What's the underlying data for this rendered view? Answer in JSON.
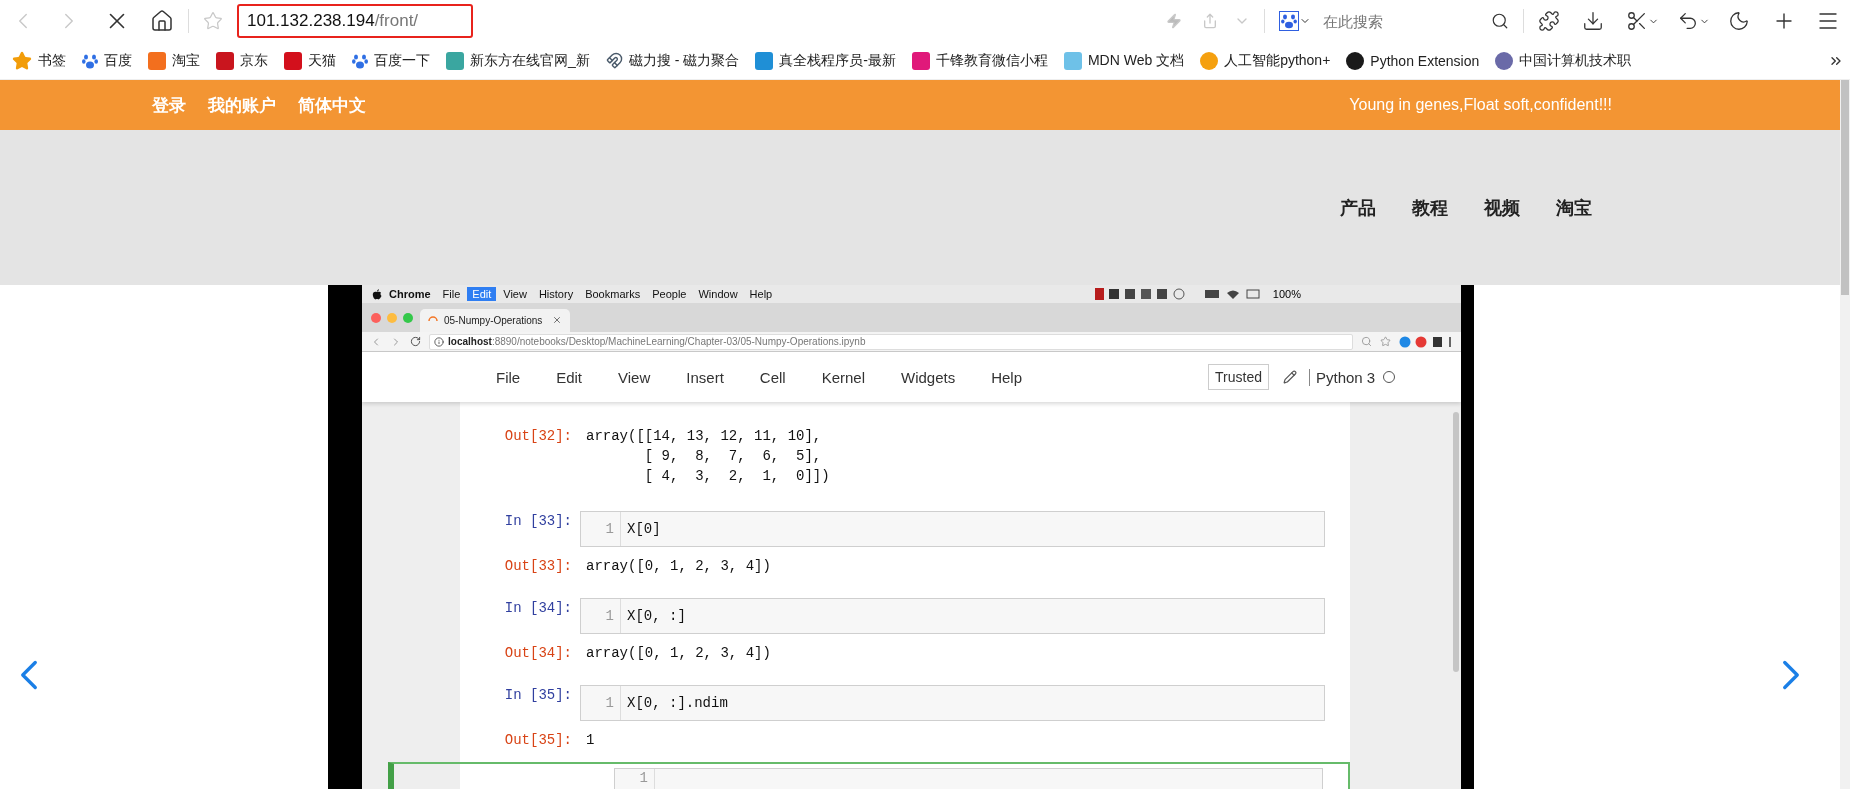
{
  "browser": {
    "address_host": "101.132.238.194",
    "address_path": "/front/",
    "search_placeholder": "在此搜索"
  },
  "bookmarks": [
    {
      "label": "书签",
      "kind": "star",
      "color": "#f29d0a"
    },
    {
      "label": "百度",
      "kind": "paw",
      "color": "#2f6fe4"
    },
    {
      "label": "淘宝",
      "kind": "tile",
      "color": "#f36f1e"
    },
    {
      "label": "京东",
      "kind": "tile",
      "color": "#c9151e"
    },
    {
      "label": "天猫",
      "kind": "tile",
      "color": "#d3101c"
    },
    {
      "label": "百度一下",
      "kind": "paw",
      "color": "#2f6fe4"
    },
    {
      "label": "新东方在线官网_新",
      "kind": "tile",
      "color": "#3aa6a0"
    },
    {
      "label": "磁力搜 - 磁力聚合",
      "kind": "magnet",
      "color": "#4a5a6a"
    },
    {
      "label": "真全栈程序员-最新",
      "kind": "tile",
      "color": "#1f8fd6"
    },
    {
      "label": "千锋教育微信小程",
      "kind": "tile",
      "color": "#e0197a"
    },
    {
      "label": "MDN Web 文档",
      "kind": "tile",
      "color": "#6ec1e8"
    },
    {
      "label": "人工智能python+",
      "kind": "circle",
      "color": "#f5a00f"
    },
    {
      "label": "Python Extension",
      "kind": "circle",
      "color": "#1a1a1a"
    },
    {
      "label": "中国计算机技术职",
      "kind": "circle",
      "color": "#6a6aa8"
    }
  ],
  "site_header": {
    "links": [
      "登录",
      "我的账户",
      "简体中文"
    ],
    "tagline": "Young in genes,Float soft,confident!!!"
  },
  "nav": [
    "产品",
    "教程",
    "视频",
    "淘宝"
  ],
  "slide": {
    "mac_menu": [
      {
        "label": "Chrome",
        "selected": false
      },
      {
        "label": "File",
        "selected": false
      },
      {
        "label": "Edit",
        "selected": true
      },
      {
        "label": "View",
        "selected": false
      },
      {
        "label": "History",
        "selected": false
      },
      {
        "label": "Bookmarks",
        "selected": false
      },
      {
        "label": "People",
        "selected": false
      },
      {
        "label": "Window",
        "selected": false
      },
      {
        "label": "Help",
        "selected": false
      }
    ],
    "battery": "100%",
    "tab_title": "05-Numpy-Operations",
    "url_host": "localhost",
    "url_rest": ":8890/notebooks/Desktop/MachineLearning/Chapter-03/05-Numpy-Operations.ipynb",
    "jupyter_menu": [
      "File",
      "Edit",
      "View",
      "Insert",
      "Cell",
      "Kernel",
      "Widgets",
      "Help"
    ],
    "trusted": "Trusted",
    "kernel": "Python 3",
    "cells": [
      {
        "kind": "output",
        "prompt": "Out[32]:",
        "lines": [
          "array([[14, 13, 12, 11, 10],",
          "       [ 9,  8,  7,  6,  5],",
          "       [ 4,  3,  2,  1,  0]])"
        ]
      },
      {
        "kind": "input",
        "prompt": "In [33]:",
        "line_no": "1",
        "code": "X[0]",
        "selected": false
      },
      {
        "kind": "output",
        "prompt": "Out[33]:",
        "lines": [
          "array([0, 1, 2, 3, 4])"
        ]
      },
      {
        "kind": "input",
        "prompt": "In [34]:",
        "line_no": "1",
        "code": "X[0, :]",
        "selected": false
      },
      {
        "kind": "output",
        "prompt": "Out[34]:",
        "lines": [
          "array([0, 1, 2, 3, 4])"
        ]
      },
      {
        "kind": "input",
        "prompt": "In [35]:",
        "line_no": "1",
        "code": "X[0, :].ndim",
        "selected": false
      },
      {
        "kind": "output",
        "prompt": "Out[35]:",
        "lines": [
          "1"
        ]
      },
      {
        "kind": "input",
        "line_no": "1",
        "selected": true
      }
    ]
  }
}
